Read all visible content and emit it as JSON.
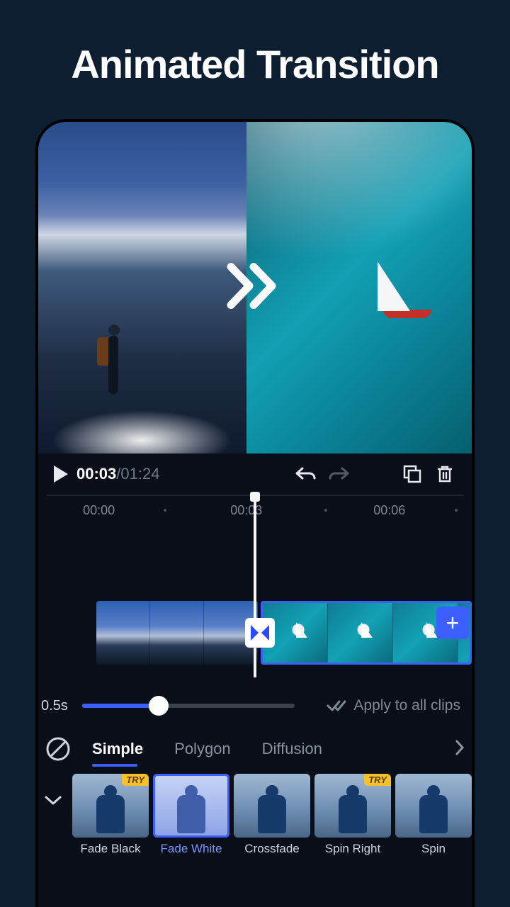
{
  "headline": "Animated Transition",
  "playback": {
    "current_time": "00:03",
    "total_time": "01:24"
  },
  "ruler": {
    "marks": [
      "00:00",
      "00:03",
      "00:06"
    ]
  },
  "duration": {
    "value_label": "0.5s"
  },
  "apply_all_label": "Apply to all clips",
  "categories": {
    "items": [
      "Simple",
      "Polygon",
      "Diffusion"
    ],
    "active_index": 0
  },
  "transitions": {
    "items": [
      {
        "label": "Fade Black",
        "try": true,
        "selected": false
      },
      {
        "label": "Fade White",
        "try": false,
        "selected": true
      },
      {
        "label": "Crossfade",
        "try": false,
        "selected": false
      },
      {
        "label": "Spin Right",
        "try": true,
        "selected": false
      },
      {
        "label": "Spin",
        "try": false,
        "selected": false
      }
    ]
  },
  "icons": {
    "add": "+"
  }
}
